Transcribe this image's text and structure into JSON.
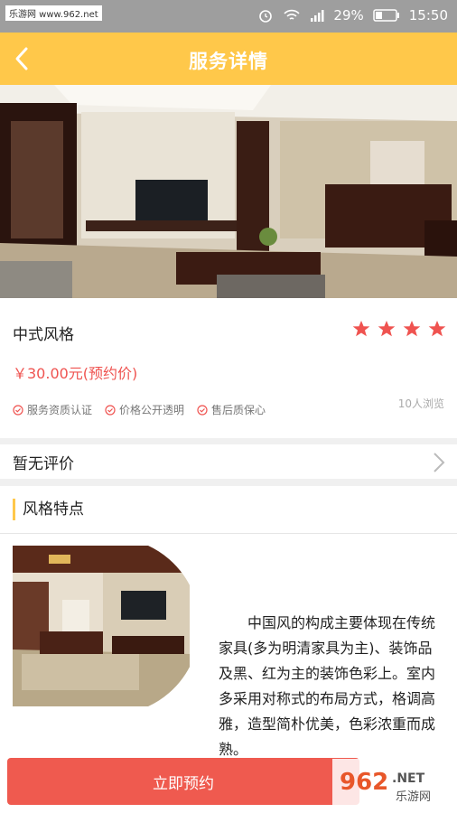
{
  "status_bar": {
    "carrier": "乐游网 www.962.net",
    "battery": "29%",
    "time": "15:50"
  },
  "nav": {
    "title": "服务详情"
  },
  "service": {
    "name": "中式风格",
    "price": "￥30.00元(预约价)",
    "rating_stars": 4,
    "badges": [
      "服务资质认证",
      "价格公开透明",
      "售后质保心"
    ],
    "views": "10人浏览"
  },
  "review": {
    "label": "暂无评价"
  },
  "feature": {
    "heading": "风格特点",
    "text": "中国风的构成主要体现在传统家具(多为明清家具为主)、装饰品及黑、红为主的装饰色彩上。室内多采用对称式的布局方式，格调高雅，造型简朴优美，色彩浓重而成熟。"
  },
  "cta": {
    "label": "立即预约"
  },
  "watermark": {
    "text": "962 NET 乐游网"
  },
  "colors": {
    "accent": "#ffc84a",
    "price": "#ef5350",
    "button": "#ef5a4f"
  }
}
